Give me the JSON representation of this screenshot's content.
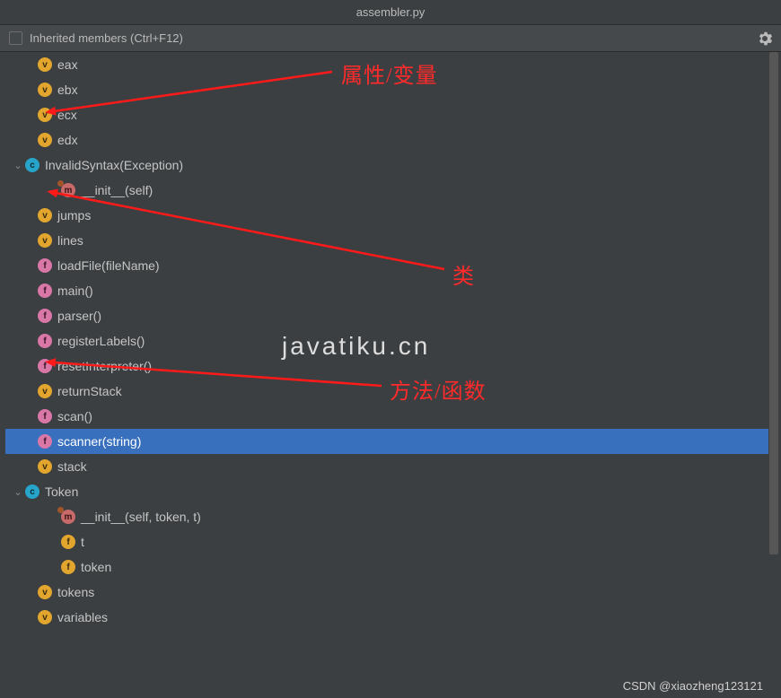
{
  "title": "assembler.py",
  "inherited_label": "Inherited members (Ctrl+F12)",
  "rows": [
    {
      "type": "v",
      "label": "eax",
      "indent": 1
    },
    {
      "type": "v",
      "label": "ebx",
      "indent": 1,
      "obscured": "x"
    },
    {
      "type": "v",
      "label": "ecx",
      "indent": 1
    },
    {
      "type": "v",
      "label": "edx",
      "indent": 1
    },
    {
      "type": "c",
      "label": "InvalidSyntax(Exception)",
      "indent": 0,
      "expand": true
    },
    {
      "type": "m",
      "label": "__init__(self)",
      "indent": 2,
      "lock": true,
      "obscured": "__init__(self)"
    },
    {
      "type": "v",
      "label": "jumps",
      "indent": 1
    },
    {
      "type": "v",
      "label": "lines",
      "indent": 1
    },
    {
      "type": "f",
      "label": "loadFile(fileName)",
      "indent": 1
    },
    {
      "type": "f",
      "label": "main()",
      "indent": 1
    },
    {
      "type": "f",
      "label": "parser()",
      "indent": 1
    },
    {
      "type": "f",
      "label": "registerLabels()",
      "indent": 1,
      "obscured": "registerLabels()"
    },
    {
      "type": "f",
      "label": "resetInterpreter()",
      "indent": 1
    },
    {
      "type": "v",
      "label": "returnStack",
      "indent": 1
    },
    {
      "type": "f",
      "label": "scan()",
      "indent": 1
    },
    {
      "type": "f",
      "label": "scanner(string)",
      "indent": 1,
      "selected": true
    },
    {
      "type": "v",
      "label": "stack",
      "indent": 1
    },
    {
      "type": "c",
      "label": "Token",
      "indent": 0,
      "expand": true
    },
    {
      "type": "m",
      "label": "__init__(self, token, t)",
      "indent": 2,
      "lock": true
    },
    {
      "type": "fy",
      "label": "t",
      "indent": 2
    },
    {
      "type": "fy",
      "label": "token",
      "indent": 2
    },
    {
      "type": "v",
      "label": "tokens",
      "indent": 1
    },
    {
      "type": "v",
      "label": "variables",
      "indent": 1
    }
  ],
  "annotations": {
    "var": "属性/变量",
    "cls": "类",
    "func": "方法/函数"
  },
  "watermark": "javatiku.cn",
  "credit": "CSDN @xiaozheng123121"
}
